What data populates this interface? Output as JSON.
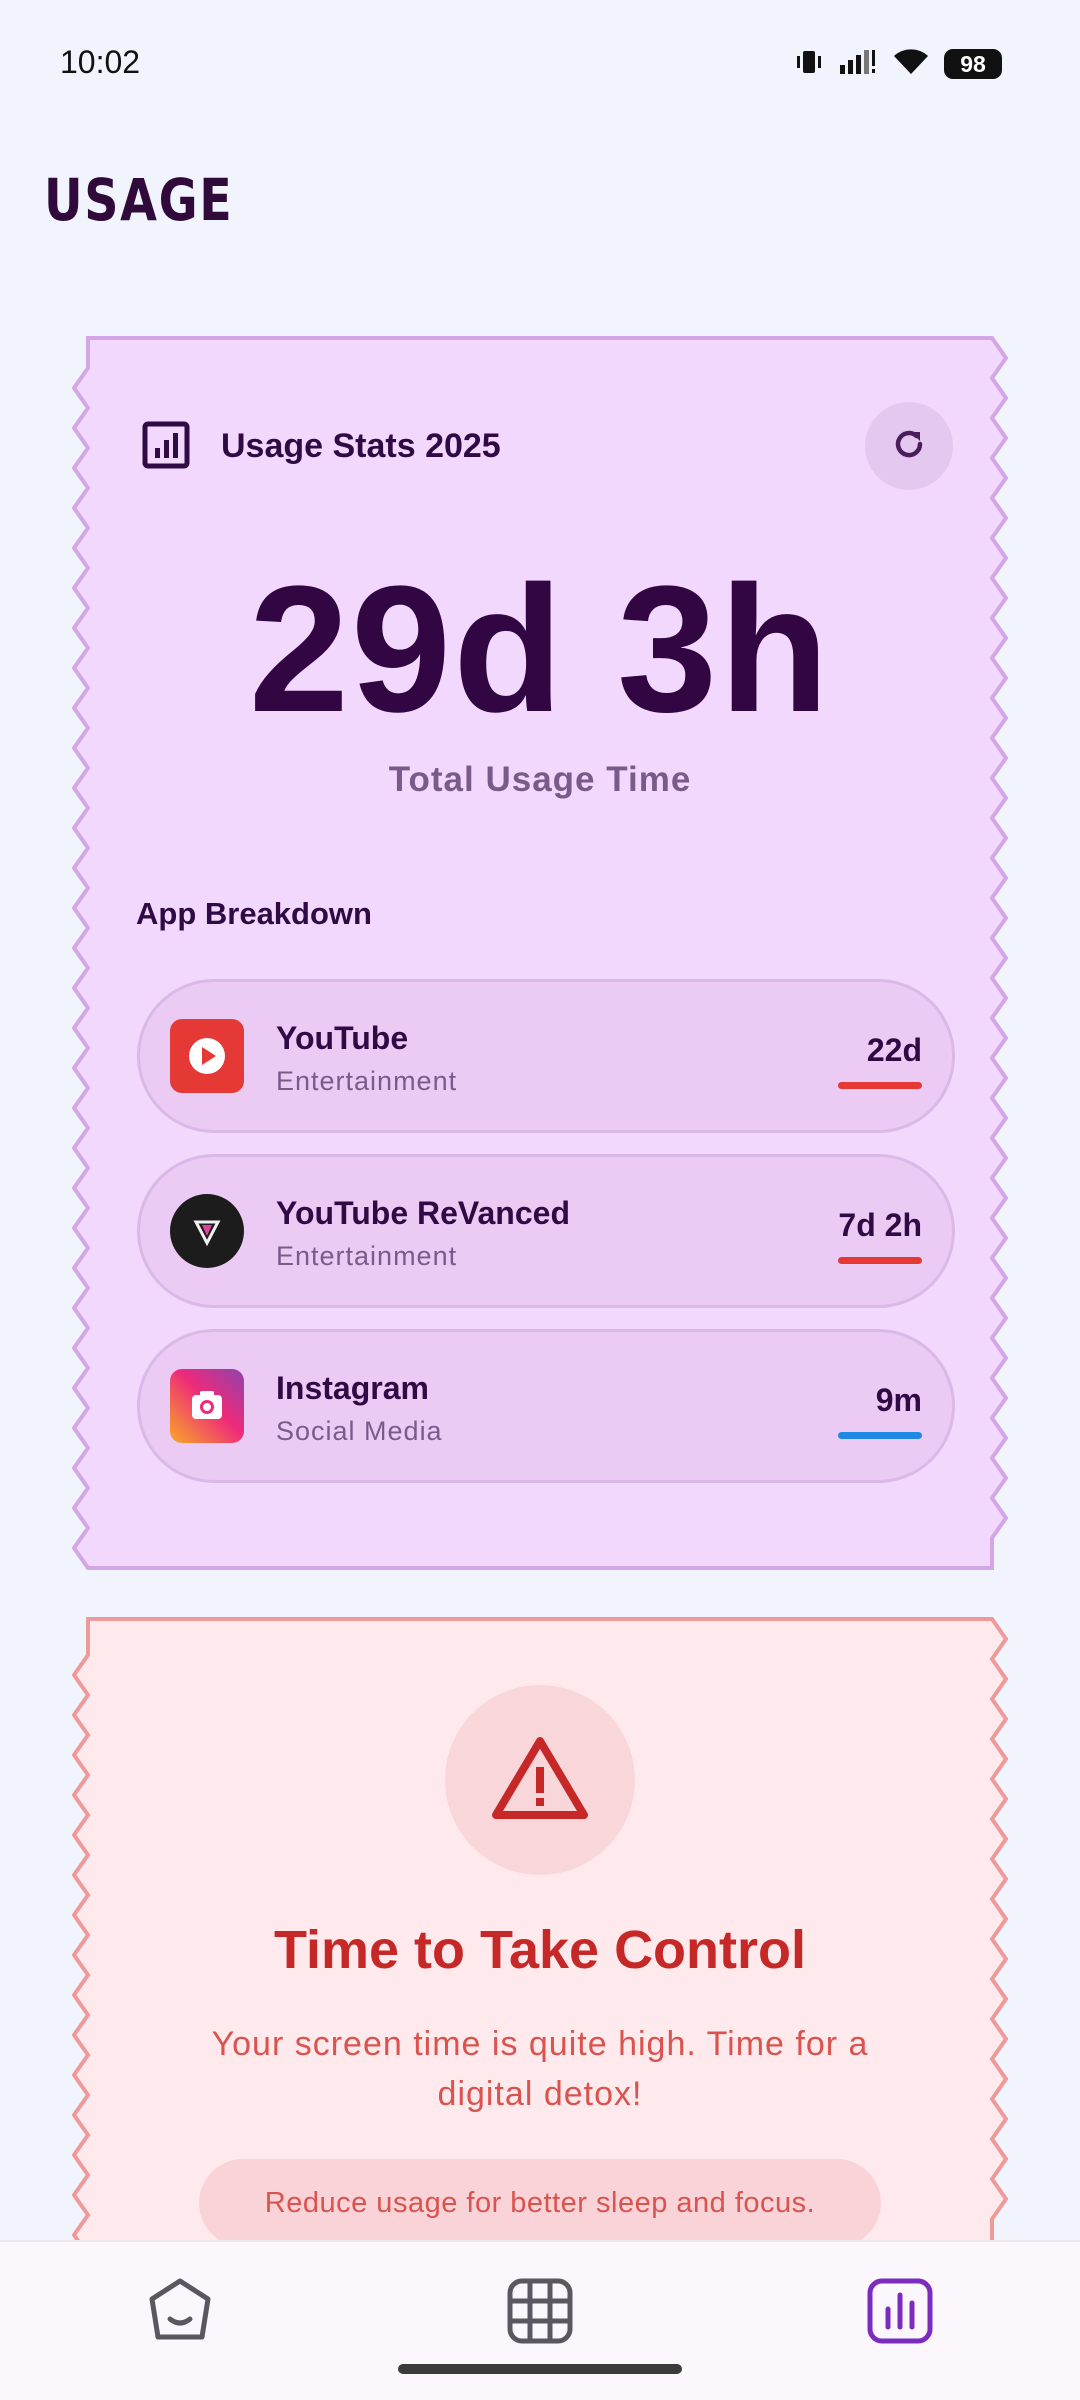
{
  "status_bar": {
    "time": "10:02",
    "battery": "98",
    "icons": [
      "vibrate-icon",
      "signal-icon",
      "wifi-icon",
      "battery-icon"
    ]
  },
  "header": {
    "title": "USAGE"
  },
  "usage_card": {
    "title": "Usage Stats 2025",
    "total_value": "29d 3h",
    "total_label": "Total Usage Time",
    "breakdown_title": "App Breakdown",
    "apps": [
      {
        "name": "YouTube",
        "category": "Entertainment",
        "time": "22d",
        "bar_color": "#e53935",
        "icon": "youtube-icon"
      },
      {
        "name": "YouTube ReVanced",
        "category": "Entertainment",
        "time": "7d 2h",
        "bar_color": "#e53935",
        "icon": "revanced-icon"
      },
      {
        "name": "Instagram",
        "category": "Social Media",
        "time": "9m",
        "bar_color": "#1e88e5",
        "icon": "instagram-icon"
      }
    ]
  },
  "warning_card": {
    "title": "Time to Take Control",
    "message": "Your screen time is quite high. Time for a digital detox!",
    "tip": "Reduce usage for better sleep and focus."
  },
  "bottom_nav": {
    "items": [
      {
        "icon": "home-icon",
        "active": false
      },
      {
        "icon": "grid-icon",
        "active": false
      },
      {
        "icon": "stats-icon",
        "active": true
      }
    ]
  },
  "colors": {
    "background": "#f1f4fc",
    "usage_card_bg": "#f3d8fd",
    "usage_card_border": "#d3a6e6",
    "warning_card_bg": "#feeaec",
    "warning_card_border": "#ef9a9a",
    "accent": "#7b2cbf",
    "danger": "#c62828"
  }
}
